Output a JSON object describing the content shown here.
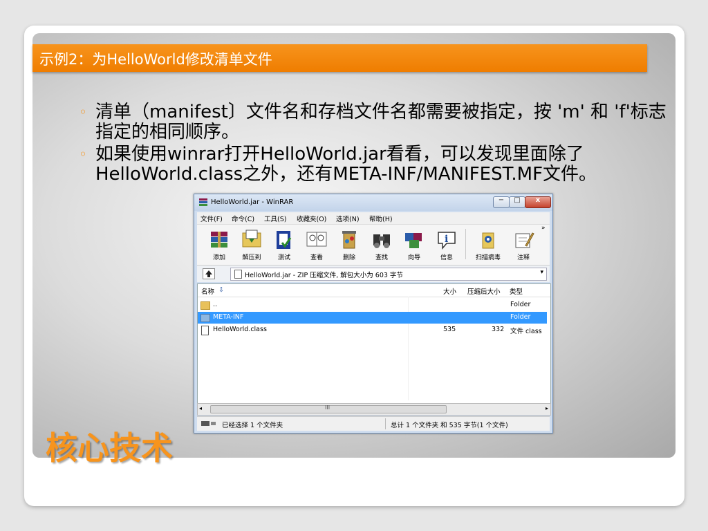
{
  "slide": {
    "title": "示例2：为HelloWorld修改清单文件",
    "bullets": [
      {
        "text": "清单（manifest〕文件名和存档文件名都需要被指定，按 'm' 和 'f'标志指定的相同顺序。"
      },
      {
        "text": "如果使用winrar打开HelloWorld.jar看看，可以发现里面除了HelloWorld.class之外，还有META-INF/MANIFEST.MF文件。"
      }
    ],
    "core_title": "核心技术",
    "accent_color": "#f7941d"
  },
  "winrar": {
    "title": "HelloWorld.jar - WinRAR",
    "menu": [
      "文件(F)",
      "命令(C)",
      "工具(S)",
      "收藏夹(O)",
      "选项(N)",
      "帮助(H)"
    ],
    "toolbar": [
      {
        "label": "添加",
        "icon": "add-archive-icon"
      },
      {
        "label": "解压到",
        "icon": "extract-to-icon"
      },
      {
        "label": "测试",
        "icon": "test-icon"
      },
      {
        "label": "查看",
        "icon": "view-icon"
      },
      {
        "label": "删除",
        "icon": "delete-icon"
      },
      {
        "label": "查找",
        "icon": "find-icon"
      },
      {
        "label": "向导",
        "icon": "wizard-icon"
      },
      {
        "label": "信息",
        "icon": "info-icon"
      },
      {
        "label": "扫描病毒",
        "icon": "virus-scan-icon"
      },
      {
        "label": "注释",
        "icon": "comment-icon"
      }
    ],
    "address": "HelloWorld.jar - ZIP 压缩文件, 解包大小为 603 字节",
    "columns": {
      "name": "名称",
      "size": "大小",
      "packed": "压缩后大小",
      "type": "类型"
    },
    "rows": [
      {
        "name": "..",
        "size": "",
        "packed": "",
        "type": "Folder",
        "icon": "folder-up-icon"
      },
      {
        "name": "META-INF",
        "size": "",
        "packed": "",
        "type": "Folder",
        "icon": "folder-icon",
        "selected": true
      },
      {
        "name": "HelloWorld.class",
        "size": "535",
        "packed": "332",
        "type": "文件 class",
        "icon": "file-icon"
      }
    ],
    "scroll_grip": "III",
    "status": {
      "left": "已经选择 1 个文件夹",
      "right": "总计 1 个文件夹 和 535 字节(1 个文件)"
    },
    "window_buttons": {
      "min": "−",
      "max": "□",
      "close": "x"
    }
  }
}
